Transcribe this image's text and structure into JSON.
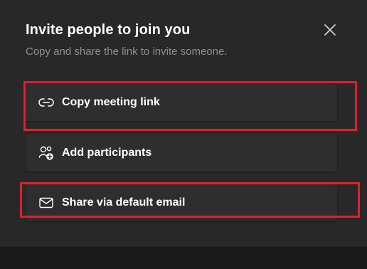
{
  "dialog": {
    "title": "Invite people to join you",
    "subtitle": "Copy and share the link to invite someone.",
    "close_icon": "close-icon"
  },
  "options": [
    {
      "label": "Copy meeting link",
      "icon": "link-icon"
    },
    {
      "label": "Add participants",
      "icon": "add-people-icon"
    },
    {
      "label": "Share via default email",
      "icon": "mail-icon"
    }
  ],
  "colors": {
    "dialog_bg": "#292828",
    "option_bg": "#2f2e2e",
    "highlight": "#e0202c",
    "title_text": "#ffffff",
    "subtitle_text": "#8e8e8e"
  }
}
